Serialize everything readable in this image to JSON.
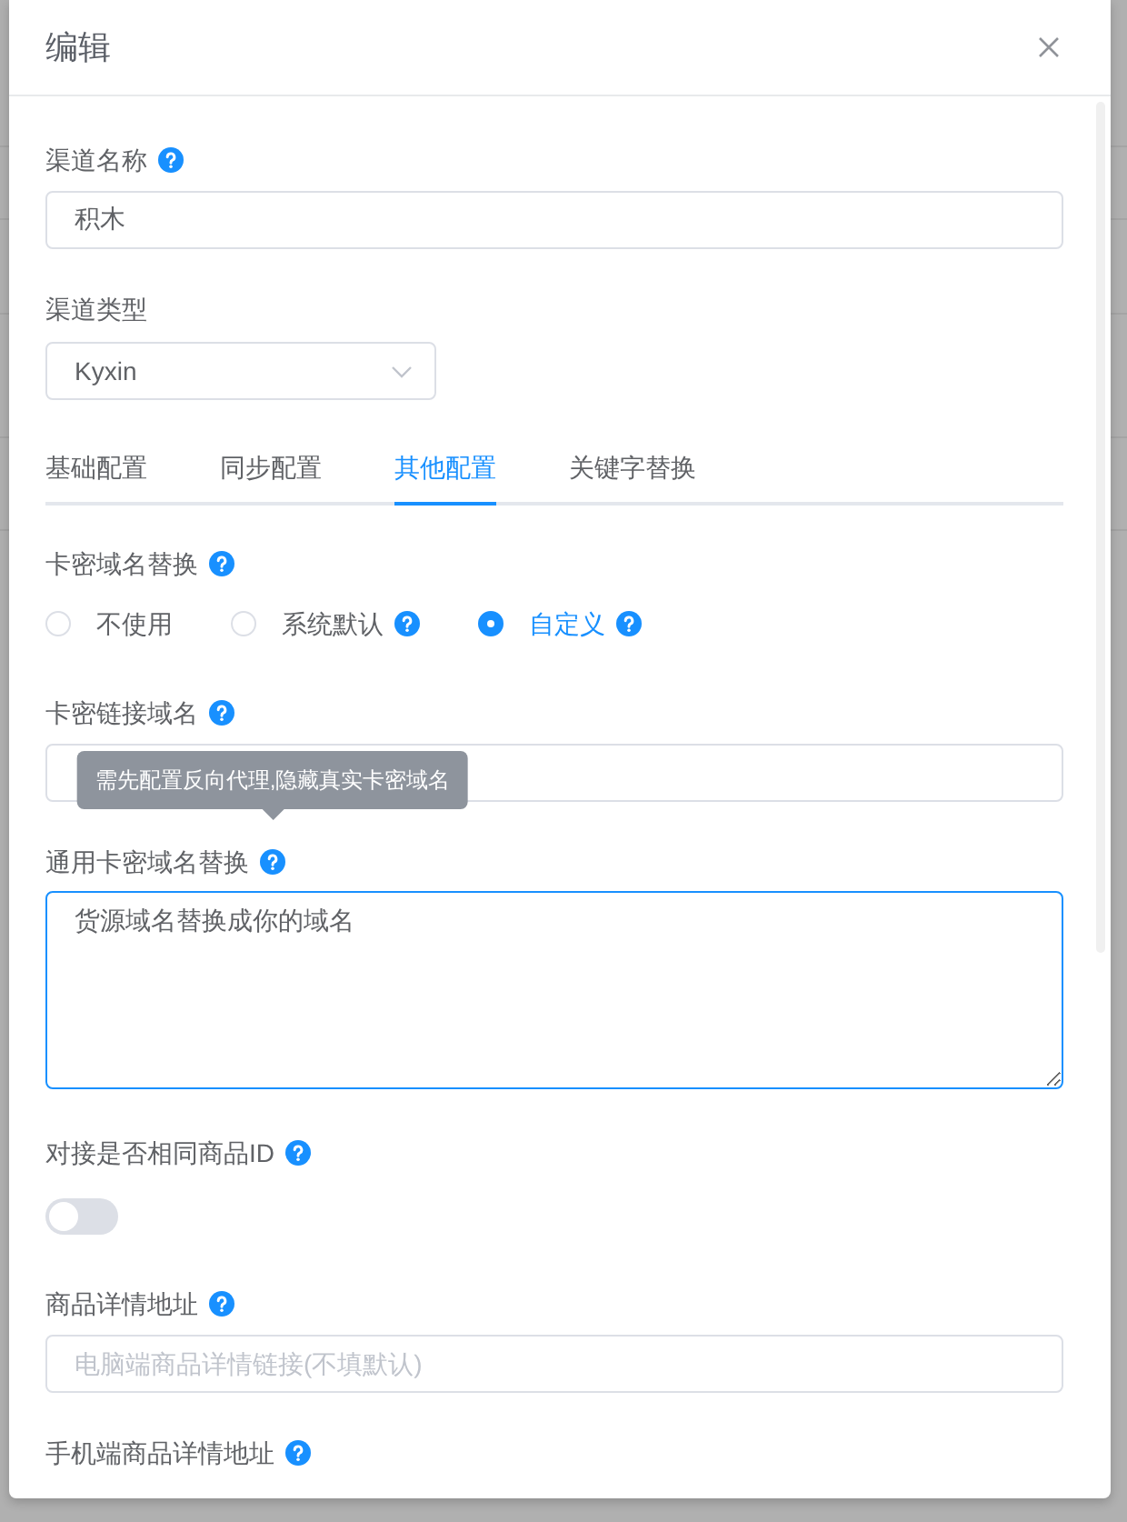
{
  "dialog": {
    "title": "编辑"
  },
  "fields": [
    {
      "kind": "input",
      "label": "渠道名称",
      "help": true,
      "value": "积木"
    },
    {
      "kind": "select",
      "label": "渠道类型",
      "value": "Kyxin"
    }
  ],
  "tabs": [
    {
      "label": "基础配置",
      "selected": false
    },
    {
      "label": "同步配置",
      "selected": false
    },
    {
      "label": "其他配置",
      "selected": true
    },
    {
      "label": "关键字替换",
      "selected": false
    }
  ],
  "tab_fields": [
    {
      "kind": "radio",
      "label": "卡密域名替换",
      "help": true,
      "options": [
        {
          "label": "不使用",
          "help": false,
          "selected": false
        },
        {
          "label": "系统默认",
          "help": true,
          "selected": false
        },
        {
          "label": "自定义",
          "help": true,
          "selected": true
        }
      ]
    },
    {
      "kind": "input",
      "label": "卡密链接域名",
      "help": true
    },
    {
      "kind": "textarea",
      "label": "通用卡密域名替换",
      "help": true,
      "tooltip": "需先配置反向代理,隐藏真实卡密域名",
      "value": "货源域名替换成你的域名",
      "focused": true
    },
    {
      "kind": "switch",
      "label": "对接是否相同商品ID",
      "help": true,
      "on": false
    },
    {
      "kind": "input",
      "label": "商品详情地址",
      "help": true,
      "placeholder": "电脑端商品详情链接(不填默认)"
    },
    {
      "kind": "label",
      "label": "手机端商品详情地址",
      "help": true
    }
  ]
}
